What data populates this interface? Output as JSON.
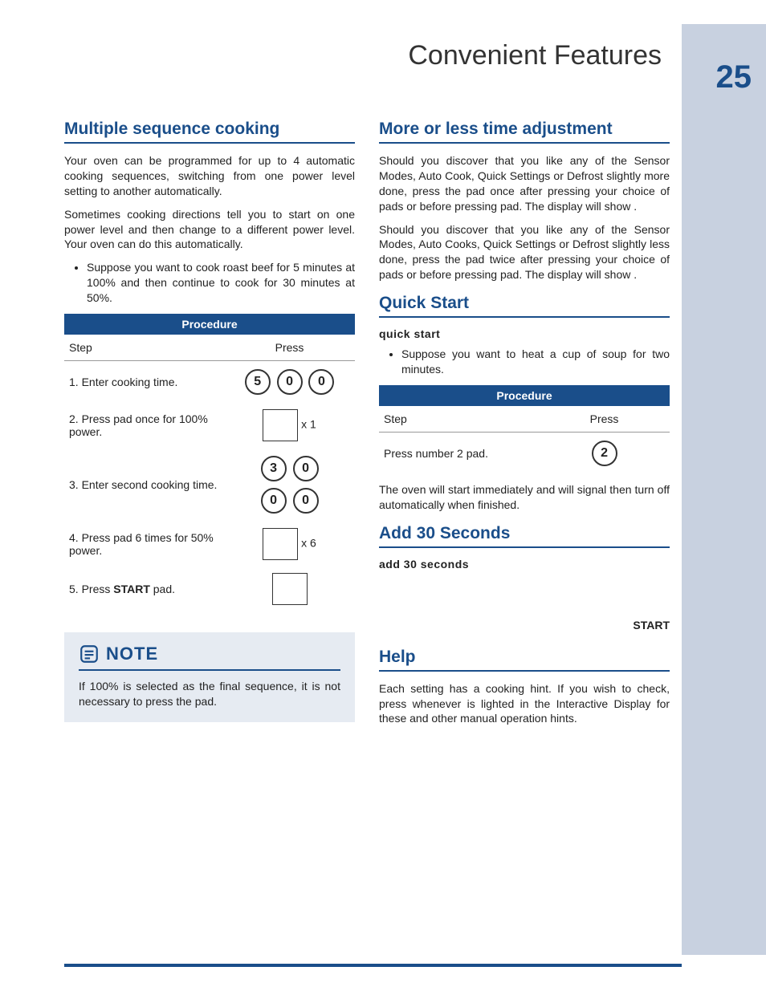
{
  "page": {
    "title": "Convenient Features",
    "number": "25"
  },
  "left": {
    "h_multiple": "Multiple sequence cooking",
    "p1": "Your oven can be programmed for up to 4 automatic cooking sequences, switching from one power level setting to another automatically.",
    "p2": "Sometimes cooking directions tell you to start on one power level and then change to a different power level. Your oven can do this automatically.",
    "bullet1": "Suppose you want to cook roast beef for 5 minutes at 100% and then continue to cook for 30 minutes at 50%.",
    "proc_label": "Procedure",
    "col_step": "Step",
    "col_press": "Press",
    "s1": "1. Enter cooking time.",
    "s2a": "2. Press ",
    "s2b": " pad once for 100% power.",
    "s2_mult": "x 1",
    "s3": "3. Enter second cooking time.",
    "s4a": "4. Press ",
    "s4b": " pad 6 times for 50% power.",
    "s4_mult": "x 6",
    "s5a": "5. Press ",
    "s5b": "START",
    "s5c": " pad.",
    "note_label": "NOTE",
    "note_body_a": "If 100% is selected as the final sequence, it is not necessary to press the ",
    "note_body_b": " pad."
  },
  "right": {
    "h_more": "More or less time adjustment",
    "more_p1a": "Should you discover that you like any of the Sensor Modes, Auto Cook, Quick Settings or Defrost slightly more done, press the ",
    "more_p1b": " pad once after pressing your choice of pads or before pressing ",
    "more_p1c": " pad. The display will show ",
    "more_p1d": ".",
    "more_p2a": "Should you discover that you like any of the Sensor Modes, Auto Cooks, Quick Settings or Defrost slightly less done, press the ",
    "more_p2b": " pad twice after pressing your choice of pads or before pressing ",
    "more_p2c": " pad. The display will show ",
    "more_p2d": ".",
    "h_quick": "Quick Start",
    "quick_sub": "quick start",
    "quick_bullet": "Suppose you want to heat a cup of soup for two minutes.",
    "proc_label": "Procedure",
    "col_step": "Step",
    "col_press": "Press",
    "quick_step": "Press number 2 pad.",
    "quick_after": "The oven will start immediately and will signal then turn off automatically when finished.",
    "h_add30": "Add 30 Seconds",
    "add30_sub": "add 30 seconds",
    "start_word": "START",
    "h_help": "Help",
    "help_p_a": "Each setting has a cooking hint. If you wish to check, press ",
    "help_p_b": " whenever ",
    "help_p_c": " is lighted in the Interactive Display for these and other manual operation hints."
  },
  "keys": {
    "five": "5",
    "zero": "0",
    "three": "3",
    "two": "2"
  }
}
